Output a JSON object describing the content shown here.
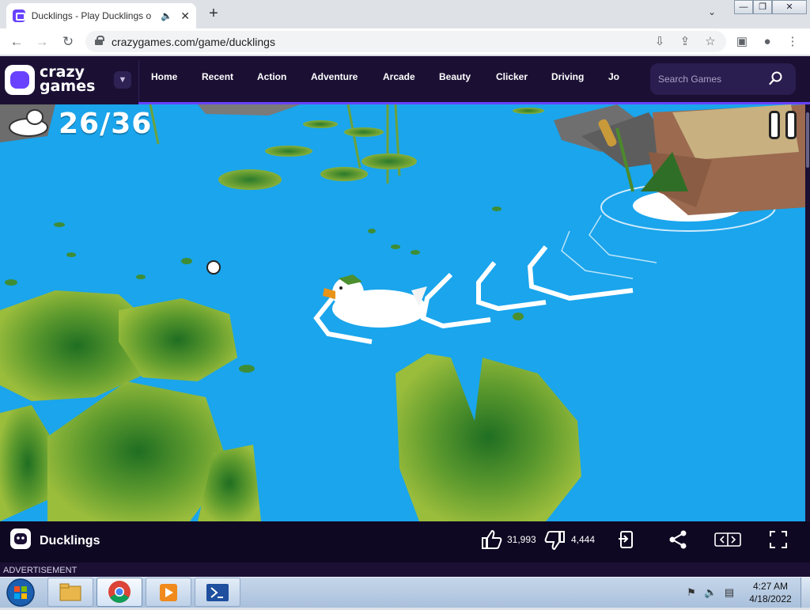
{
  "browser": {
    "tab_title": "Ducklings - Play Ducklings o",
    "tab_audio_icon": "speaker-icon",
    "new_tab_label": "+",
    "url": "crazygames.com/game/ducklings",
    "window_controls": [
      "minimize",
      "maximize",
      "close"
    ]
  },
  "site": {
    "logo_word1": "crazy",
    "logo_word2": "games",
    "nav": [
      "Home",
      "Recent",
      "Action",
      "Adventure",
      "Arcade",
      "Beauty",
      "Clicker",
      "Driving",
      "Jo"
    ],
    "search_placeholder": "Search Games",
    "brand_color": "#6842ff",
    "header_bg": "#1b1034"
  },
  "game": {
    "counter": "26/36",
    "counter_current": 26,
    "counter_total": 36,
    "water_color": "#1aa5ec",
    "lilypad_color": "#6fa632"
  },
  "game_bar": {
    "title": "Ducklings",
    "likes": "31,993",
    "dislikes": "4,444",
    "buttons": [
      "like-icon",
      "dislike-icon",
      "report-icon",
      "share-icon",
      "theater-mode-icon",
      "fullscreen-icon"
    ]
  },
  "ad": {
    "label": "ADVERTISEMENT"
  },
  "taskbar": {
    "time": "4:27 AM",
    "date": "4/18/2022",
    "apps": [
      "file-explorer-icon",
      "chrome-icon",
      "media-player-icon",
      "powershell-icon"
    ]
  }
}
